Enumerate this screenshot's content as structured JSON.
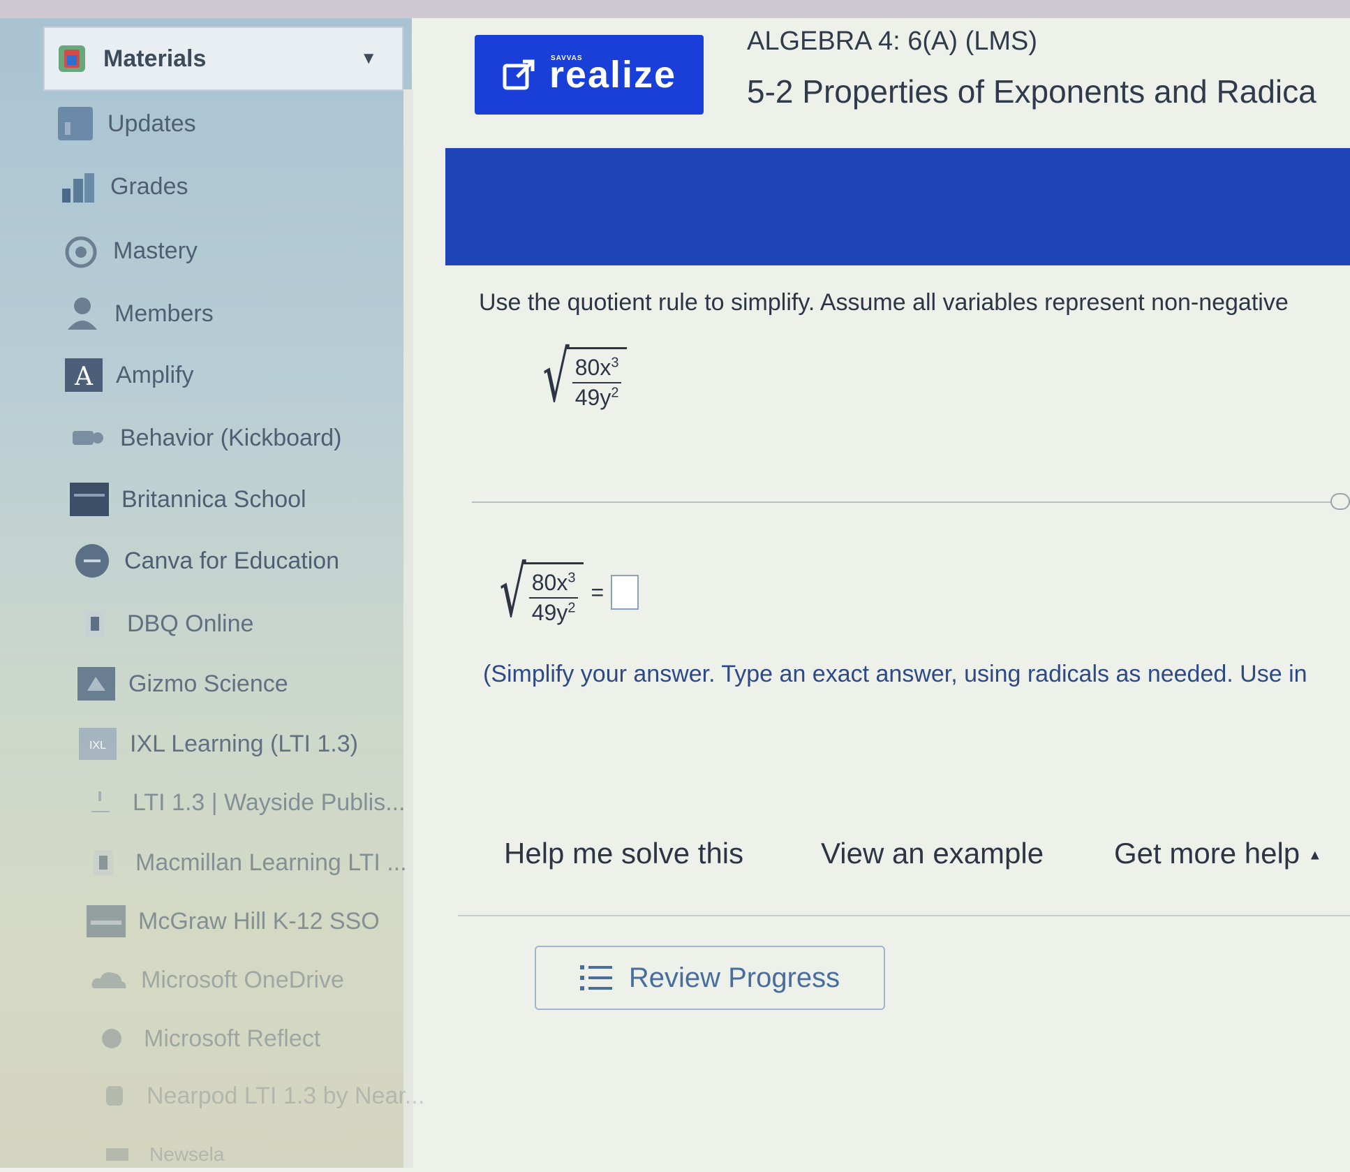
{
  "sidebar": {
    "materials_label": "Materials",
    "items": [
      {
        "label": "Updates"
      },
      {
        "label": "Grades"
      },
      {
        "label": "Mastery"
      },
      {
        "label": "Members"
      },
      {
        "label": "Amplify"
      },
      {
        "label": "Behavior (Kickboard)"
      },
      {
        "label": "Britannica School"
      },
      {
        "label": "Canva for Education"
      },
      {
        "label": "DBQ Online"
      },
      {
        "label": "Gizmo Science"
      },
      {
        "label": "IXL Learning (LTI 1.3)"
      },
      {
        "label": "LTI 1.3 | Wayside Publis..."
      },
      {
        "label": "Macmillan Learning LTI ..."
      },
      {
        "label": "McGraw Hill K-12 SSO"
      },
      {
        "label": "Microsoft OneDrive"
      },
      {
        "label": "Microsoft Reflect"
      },
      {
        "label": "Nearpod LTI 1.3 by Near..."
      },
      {
        "label": "Newsela"
      }
    ]
  },
  "header": {
    "realize_label": "realize",
    "savvas_label": "SAVVAS",
    "course": "ALGEBRA 4: 6(A) (LMS)",
    "lesson": "5-2 Properties of Exponents and Radica"
  },
  "problem": {
    "instruction": "Use the quotient rule to simplify. Assume all variables represent non-negative",
    "numerator_coef": "80x",
    "numerator_exp": "3",
    "denominator_coef": "49y",
    "denominator_exp": "2",
    "equals": "=",
    "hint": "(Simplify your answer. Type an exact answer, using radicals as needed. Use in"
  },
  "help": {
    "help_me_solve": "Help me solve this",
    "view_example": "View an example",
    "get_more_help": "Get more help",
    "get_more_help_arrow": "▲"
  },
  "review": {
    "label": "Review Progress"
  },
  "colors": {
    "banner": "#1f45b8",
    "realize_button": "#1a3fd8",
    "link_text": "#2e4a86"
  }
}
